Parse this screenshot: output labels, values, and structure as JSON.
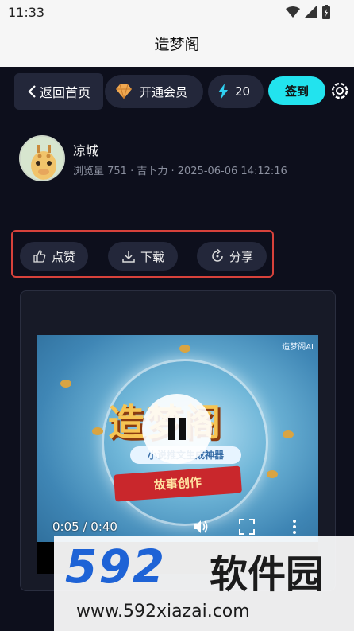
{
  "status_bar": {
    "time": "11:33"
  },
  "app": {
    "title": "造梦阁"
  },
  "toolbar": {
    "back_label": "返回首页",
    "vip_label": "开通会员",
    "energy_count": "20",
    "signin_label": "签到"
  },
  "user": {
    "name": "凉城",
    "meta": "浏览量 751 · 吉卜力 · 2025-06-06 14:12:16"
  },
  "actions": {
    "like_label": "点赞",
    "download_label": "下载",
    "share_label": "分享"
  },
  "video": {
    "brand_mark": "造梦阁AI",
    "title_art": "造梦阁",
    "subtitle_art": "小说推文生成神器",
    "ribbon_text": "故事创作",
    "time_readout": "0:05 / 0:40"
  },
  "watermark": {
    "number": "592",
    "name": "软件园",
    "url": "www.592xiazai.com"
  },
  "colors": {
    "background": "#0d0f1c",
    "signin_accent": "#22e3ee",
    "highlight_border": "#d7423b",
    "watermark_blue": "#1e63d6"
  }
}
